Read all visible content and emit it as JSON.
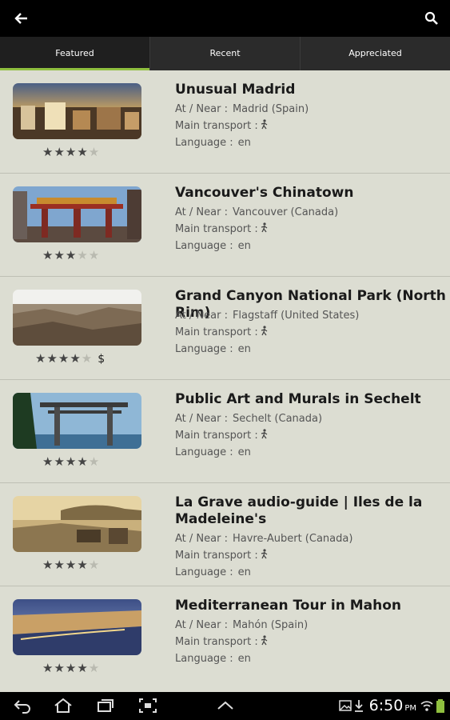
{
  "tabs": [
    {
      "label": "Featured"
    },
    {
      "label": "Recent"
    },
    {
      "label": "Appreciated"
    }
  ],
  "labels": {
    "near": "At / Near :",
    "transport": "Main transport :",
    "language": "Language :"
  },
  "tours": [
    {
      "title": "Unusual Madrid",
      "near": "Madrid (Spain)",
      "language": "en",
      "rating": 4.5,
      "price": ""
    },
    {
      "title": "Vancouver's Chinatown",
      "near": "Vancouver (Canada)",
      "language": "en",
      "rating": 3,
      "price": ""
    },
    {
      "title": "Grand Canyon National Park (North Rim)",
      "near": "Flagstaff (United States)",
      "language": "en",
      "rating": 3.5,
      "price": "$"
    },
    {
      "title": "Public Art and Murals in Sechelt",
      "near": "Sechelt (Canada)",
      "language": "en",
      "rating": 4.5,
      "price": ""
    },
    {
      "title": "La Grave audio-guide | Iles de la Madeleine's",
      "near": "Havre-Aubert (Canada)",
      "language": "en",
      "rating": 4.5,
      "price": ""
    },
    {
      "title": "Mediterranean Tour in Mahon",
      "near": "Mahón (Spain)",
      "language": "en",
      "rating": 4.5,
      "price": ""
    }
  ],
  "status": {
    "time": "6:50",
    "ampm": "PM"
  },
  "colors": {
    "accent": "#8fbf3f",
    "list_bg": "#dcddd2",
    "bar_bg": "#000000"
  },
  "icons": [
    "back-arrow-icon",
    "search-icon",
    "walking-person-icon",
    "star-icon",
    "nav-back-icon",
    "nav-home-icon",
    "nav-recent-apps-icon",
    "screenshot-icon",
    "nav-up-icon",
    "image-notification-icon",
    "download-icon",
    "wifi-icon",
    "battery-icon"
  ]
}
